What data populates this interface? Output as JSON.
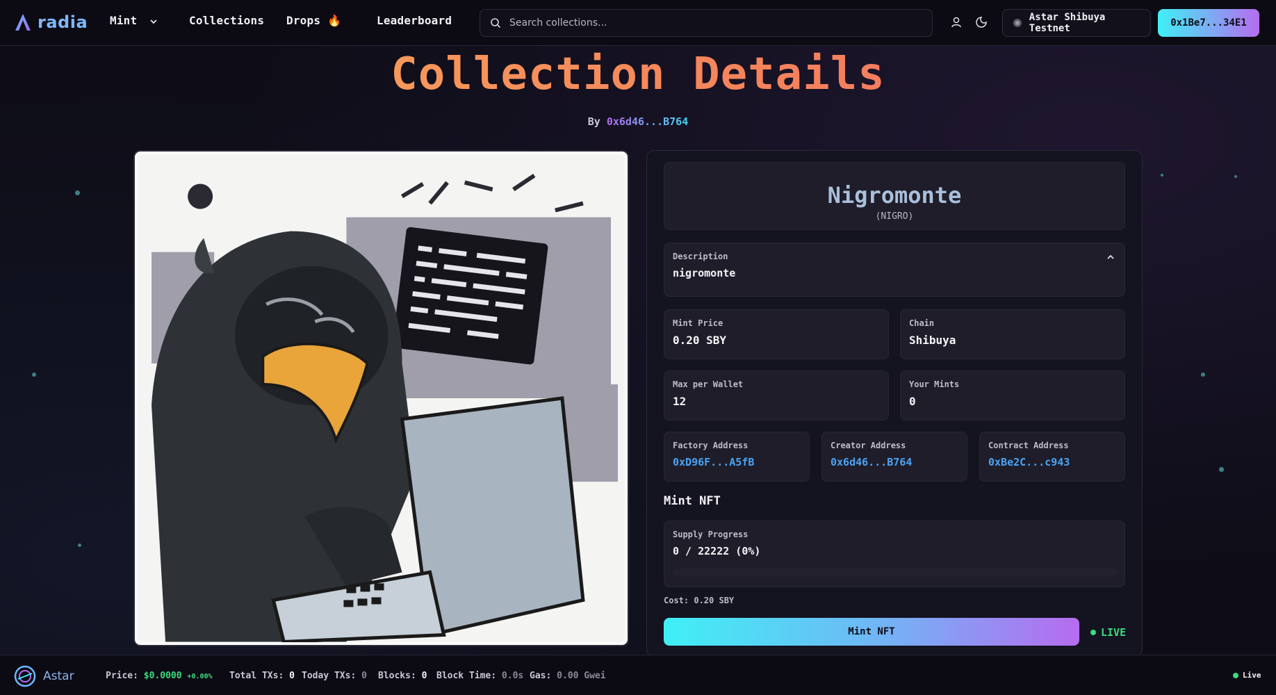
{
  "nav": {
    "logo_text": "radia",
    "links": {
      "mint": "Mint",
      "collections": "Collections",
      "drops": "Drops 🔥",
      "leaderboard": "Leaderboard"
    },
    "search_placeholder": "Search collections...",
    "network_label": "Astar Shibuya Testnet",
    "wallet_label": "0x1Be7...34E1"
  },
  "header": {
    "title": "Collection Details",
    "by_label": "By",
    "creator_short": "0x6d46...B764"
  },
  "collection": {
    "name": "Nigromonte",
    "symbol": "(NIGRO)",
    "description_label": "Description",
    "description": "nigromonte",
    "mint_price_label": "Mint Price",
    "mint_price": "0.20 SBY",
    "chain_label": "Chain",
    "chain": "Shibuya",
    "max_per_wallet_label": "Max per Wallet",
    "max_per_wallet": "12",
    "your_mints_label": "Your Mints",
    "your_mints": "0",
    "factory_label": "Factory Address",
    "factory": "0xD96F...A5fB",
    "creator_label": "Creator Address",
    "creator": "0x6d46...B764",
    "contract_label": "Contract Address",
    "contract": "0xBe2C...c943"
  },
  "mint": {
    "section_title": "Mint NFT",
    "supply_label": "Supply Progress",
    "supply_text": "0 / 22222 (0%)",
    "supply_fraction": 0,
    "cost": "Cost: 0.20 SBY",
    "button_label": "Mint NFT",
    "live_label": "LIVE"
  },
  "status_bar": {
    "chain_name": "Astar",
    "price_label": "Price:",
    "price": "$0.0000",
    "price_change": "+0.00%",
    "total_txs_label": "Total TXs:",
    "total_txs": "0",
    "today_txs_label": "Today TXs:",
    "today_txs": "0",
    "blocks_label": "Blocks:",
    "blocks": "0",
    "block_time_label": "Block Time:",
    "block_time": "0.0s",
    "gas_label": "Gas:",
    "gas": "0.00 Gwei",
    "live_label": "Live"
  },
  "colors": {
    "accent_cyan": "#3ff0f5",
    "accent_purple": "#b66cf0",
    "title_orange": "#f5895b",
    "link_blue": "#4aa4f5",
    "live_green": "#3ddb7e"
  }
}
